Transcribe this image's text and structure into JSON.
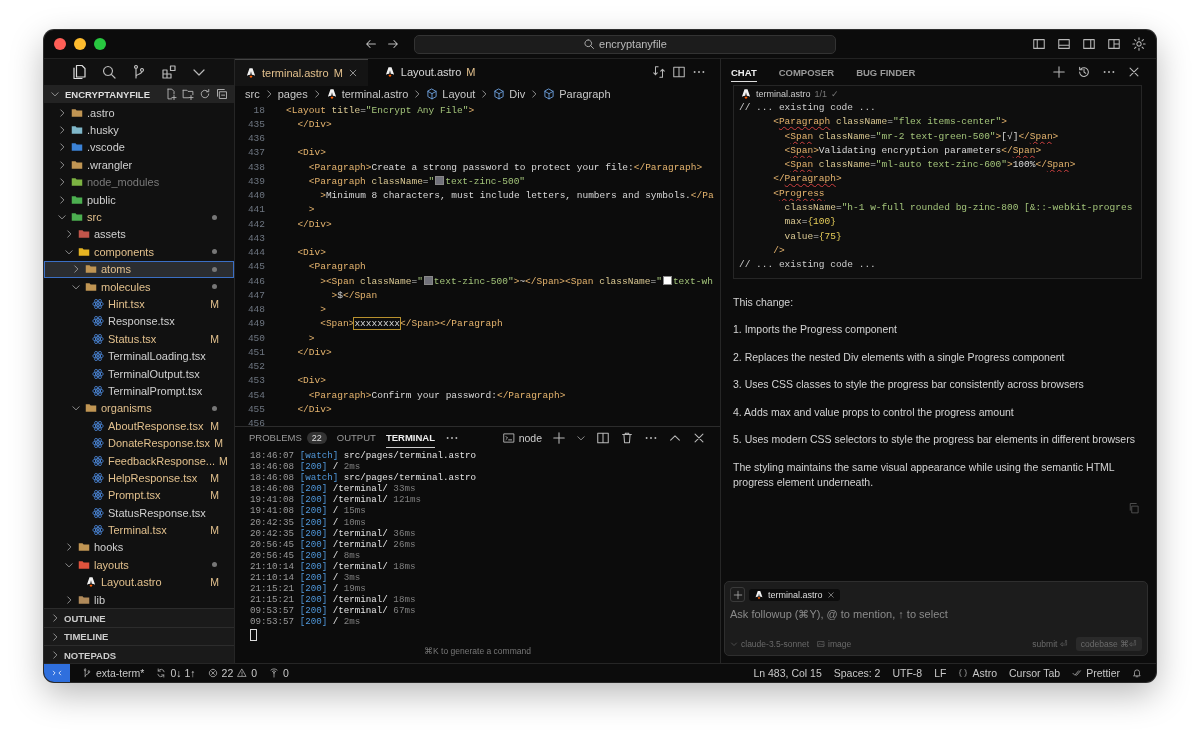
{
  "window": {
    "search": "encryptanyfile"
  },
  "sidebar": {
    "project": "ENCRYPTANYFILE",
    "tree": [
      {
        "name": ".astro",
        "kind": "folder",
        "color": "#c09553",
        "expanded": false,
        "modified": false,
        "ignored": false,
        "selected": false
      },
      {
        "name": ".husky",
        "kind": "folder",
        "color": "#7fb7c9",
        "expanded": false,
        "modified": false,
        "ignored": false,
        "selected": false
      },
      {
        "name": ".vscode",
        "kind": "folder",
        "color": "#3b82d6",
        "expanded": false,
        "modified": false,
        "ignored": false,
        "selected": false
      },
      {
        "name": ".wrangler",
        "kind": "folder",
        "color": "#c09553",
        "expanded": false,
        "modified": false,
        "ignored": false,
        "selected": false
      },
      {
        "name": "node_modules",
        "kind": "folder",
        "color": "#7cb342",
        "expanded": false,
        "modified": false,
        "ignored": true,
        "selected": false
      },
      {
        "name": "public",
        "kind": "folder",
        "color": "#4caf50",
        "expanded": false,
        "modified": false,
        "ignored": false,
        "selected": false
      },
      {
        "name": "src",
        "kind": "folder",
        "color": "#4caf50",
        "expanded": true,
        "modified": true,
        "ignored": false,
        "selected": false,
        "children": [
          {
            "name": "assets",
            "kind": "folder",
            "color": "#c2554a",
            "expanded": false,
            "modified": false,
            "ignored": false,
            "selected": false
          },
          {
            "name": "components",
            "kind": "folder",
            "color": "#e6b422",
            "expanded": true,
            "modified": true,
            "ignored": false,
            "selected": false,
            "children": [
              {
                "name": "atoms",
                "kind": "folder",
                "color": "#c09553",
                "expanded": false,
                "modified": true,
                "ignored": false,
                "selected": true
              },
              {
                "name": "molecules",
                "kind": "folder",
                "color": "#c09553",
                "expanded": true,
                "modified": true,
                "ignored": false,
                "selected": false,
                "children": [
                  {
                    "name": "Hint.tsx",
                    "kind": "react",
                    "modified": true,
                    "ignored": false,
                    "badge": "M",
                    "selected": false
                  },
                  {
                    "name": "Response.tsx",
                    "kind": "react",
                    "modified": false,
                    "ignored": false,
                    "selected": false
                  },
                  {
                    "name": "Status.tsx",
                    "kind": "react",
                    "modified": true,
                    "ignored": false,
                    "badge": "M",
                    "selected": false
                  },
                  {
                    "name": "TerminalLoading.tsx",
                    "kind": "react",
                    "modified": false,
                    "ignored": false,
                    "selected": false
                  },
                  {
                    "name": "TerminalOutput.tsx",
                    "kind": "react",
                    "modified": false,
                    "ignored": false,
                    "selected": false
                  },
                  {
                    "name": "TerminalPrompt.tsx",
                    "kind": "react",
                    "modified": false,
                    "ignored": false,
                    "selected": false
                  }
                ]
              },
              {
                "name": "organisms",
                "kind": "folder",
                "color": "#c09553",
                "expanded": true,
                "modified": true,
                "ignored": false,
                "selected": false,
                "children": [
                  {
                    "name": "AboutResponse.tsx",
                    "kind": "react",
                    "modified": true,
                    "ignored": false,
                    "badge": "M",
                    "selected": false
                  },
                  {
                    "name": "DonateResponse.tsx",
                    "kind": "react",
                    "modified": true,
                    "ignored": false,
                    "badge": "M",
                    "selected": false
                  },
                  {
                    "name": "FeedbackResponse...",
                    "kind": "react",
                    "modified": true,
                    "ignored": false,
                    "badge": "M",
                    "selected": false
                  },
                  {
                    "name": "HelpResponse.tsx",
                    "kind": "react",
                    "modified": true,
                    "ignored": false,
                    "badge": "M",
                    "selected": false
                  },
                  {
                    "name": "Prompt.tsx",
                    "kind": "react",
                    "modified": true,
                    "ignored": false,
                    "badge": "M",
                    "selected": false
                  },
                  {
                    "name": "StatusResponse.tsx",
                    "kind": "react",
                    "modified": false,
                    "ignored": false,
                    "selected": false
                  },
                  {
                    "name": "Terminal.tsx",
                    "kind": "react",
                    "modified": true,
                    "ignored": false,
                    "badge": "M",
                    "selected": false
                  }
                ]
              }
            ]
          },
          {
            "name": "hooks",
            "kind": "folder",
            "color": "#c09553",
            "expanded": false,
            "modified": false,
            "ignored": false,
            "selected": false
          },
          {
            "name": "layouts",
            "kind": "folder",
            "color": "#e0533d",
            "expanded": true,
            "modified": true,
            "ignored": false,
            "selected": false,
            "children": [
              {
                "name": "Layout.astro",
                "kind": "astro",
                "modified": true,
                "ignored": false,
                "badge": "M",
                "selected": false
              }
            ]
          },
          {
            "name": "lib",
            "kind": "folder",
            "color": "#b08a5a",
            "expanded": false,
            "modified": false,
            "ignored": false,
            "selected": false
          }
        ]
      }
    ],
    "sections": [
      {
        "label": "OUTLINE",
        "expanded": false
      },
      {
        "label": "TIMELINE",
        "expanded": false
      },
      {
        "label": "NOTEPADS",
        "expanded": false
      }
    ]
  },
  "editor": {
    "tabs": [
      {
        "label": "terminal.astro",
        "badge": "M",
        "selected": true
      },
      {
        "label": "Layout.astro",
        "badge": "M",
        "selected": false
      }
    ],
    "breadcrumbs": [
      {
        "label": "src",
        "kind": "folder"
      },
      {
        "label": "pages",
        "kind": "folder"
      },
      {
        "label": "terminal.astro",
        "kind": "file"
      },
      {
        "label": "Layout",
        "kind": "symbol"
      },
      {
        "label": "Div",
        "kind": "symbol"
      },
      {
        "label": "Paragraph",
        "kind": "symbol"
      }
    ],
    "lines": [
      {
        "n": "18",
        "tokens": [
          {
            "kind": "tag",
            "text": "<Layout"
          },
          {
            "kind": "attr",
            "text": " title"
          },
          {
            "kind": "punct",
            "text": "="
          },
          {
            "kind": "str",
            "text": "\"Encrypt Any File\""
          },
          {
            "kind": "tag",
            "text": ">"
          }
        ]
      },
      {
        "n": "435",
        "tokens": [
          {
            "kind": "tag",
            "text": "  </Div>"
          }
        ]
      },
      {
        "n": "436"
      },
      {
        "n": "437",
        "tokens": [
          {
            "kind": "tag",
            "text": "  <Div>"
          }
        ]
      },
      {
        "n": "438",
        "tokens": [
          {
            "kind": "tag",
            "text": "    <Paragraph>"
          },
          {
            "kind": "text",
            "text": "Create a strong password to protect your file:"
          },
          {
            "kind": "tag",
            "text": "</Paragraph>"
          }
        ]
      },
      {
        "n": "439",
        "tokens": [
          {
            "kind": "tag",
            "text": "    <Paragraph"
          },
          {
            "kind": "attr",
            "text": " className"
          },
          {
            "kind": "punct",
            "text": "="
          },
          {
            "kind": "str",
            "text": "\""
          },
          {
            "kind": "swatch",
            "color": "#71717a"
          },
          {
            "kind": "str",
            "text": "text-zinc-500\""
          }
        ]
      },
      {
        "n": "440",
        "tokens": [
          {
            "kind": "tag",
            "text": "      >"
          },
          {
            "kind": "text",
            "text": "Minimum 8 characters, must include letters, numbers and symbols."
          },
          {
            "kind": "tag",
            "text": "</Pa"
          }
        ]
      },
      {
        "n": "441",
        "tokens": [
          {
            "kind": "tag",
            "text": "    >"
          }
        ]
      },
      {
        "n": "442",
        "tokens": [
          {
            "kind": "tag",
            "text": "  </Div>"
          }
        ]
      },
      {
        "n": "443"
      },
      {
        "n": "444",
        "tokens": [
          {
            "kind": "tag",
            "text": "  <Div>"
          }
        ]
      },
      {
        "n": "445",
        "tokens": [
          {
            "kind": "tag",
            "text": "    <Paragraph"
          }
        ]
      },
      {
        "n": "446",
        "tokens": [
          {
            "kind": "tag",
            "text": "      ><Span"
          },
          {
            "kind": "attr",
            "text": " className"
          },
          {
            "kind": "punct",
            "text": "="
          },
          {
            "kind": "str",
            "text": "\""
          },
          {
            "kind": "swatch",
            "color": "#71717a"
          },
          {
            "kind": "str",
            "text": "text-zinc-500\""
          },
          {
            "kind": "tag",
            "text": ">"
          },
          {
            "kind": "text",
            "text": "~"
          },
          {
            "kind": "tag",
            "text": "</Span><Span"
          },
          {
            "kind": "attr",
            "text": " className"
          },
          {
            "kind": "punct",
            "text": "="
          },
          {
            "kind": "str",
            "text": "\""
          },
          {
            "kind": "swatch",
            "color": "#ffffff"
          },
          {
            "kind": "str",
            "text": "text-wh"
          }
        ]
      },
      {
        "n": "447",
        "tokens": [
          {
            "kind": "tag",
            "text": "        >"
          },
          {
            "kind": "text",
            "text": "$"
          },
          {
            "kind": "tag",
            "text": "</Span"
          }
        ]
      },
      {
        "n": "448",
        "tokens": [
          {
            "kind": "tag",
            "text": "      >"
          }
        ]
      },
      {
        "n": "449",
        "tokens": [
          {
            "kind": "tag",
            "text": "      <Span>"
          },
          {
            "kind": "match",
            "text": "xxxxxxxx"
          },
          {
            "kind": "tag",
            "text": "</Span></Paragraph"
          }
        ]
      },
      {
        "n": "450",
        "tokens": [
          {
            "kind": "tag",
            "text": "    >"
          }
        ]
      },
      {
        "n": "451",
        "tokens": [
          {
            "kind": "tag",
            "text": "  </Div>"
          }
        ]
      },
      {
        "n": "452"
      },
      {
        "n": "453",
        "tokens": [
          {
            "kind": "tag",
            "text": "  <Div>"
          }
        ]
      },
      {
        "n": "454",
        "tokens": [
          {
            "kind": "tag",
            "text": "    <Paragraph>"
          },
          {
            "kind": "text",
            "text": "Confirm your password:"
          },
          {
            "kind": "tag",
            "text": "</Paragraph>"
          }
        ]
      },
      {
        "n": "455",
        "tokens": [
          {
            "kind": "tag",
            "text": "  </Div>"
          }
        ]
      },
      {
        "n": "456"
      }
    ]
  },
  "panel": {
    "tabs": [
      {
        "label": "PROBLEMS",
        "count": "22",
        "selected": false
      },
      {
        "label": "OUTPUT",
        "selected": false
      },
      {
        "label": "TERMINAL",
        "selected": true
      }
    ],
    "shell": "node",
    "log": [
      {
        "time": "18:46:07",
        "tag": "[watch]",
        "path": "src/pages/terminal.astro"
      },
      {
        "time": "18:46:08",
        "tag": "[200]",
        "path": "/",
        "ms": "2ms"
      },
      {
        "time": "18:46:08",
        "tag": "[watch]",
        "path": "src/pages/terminal.astro"
      },
      {
        "time": "18:46:08",
        "tag": "[200]",
        "path": "/terminal/",
        "ms": "33ms"
      },
      {
        "time": "19:41:08",
        "tag": "[200]",
        "path": "/terminal/",
        "ms": "121ms"
      },
      {
        "time": "19:41:08",
        "tag": "[200]",
        "path": "/",
        "ms": "15ms"
      },
      {
        "time": "20:42:35",
        "tag": "[200]",
        "path": "/",
        "ms": "10ms"
      },
      {
        "time": "20:42:35",
        "tag": "[200]",
        "path": "/terminal/",
        "ms": "36ms"
      },
      {
        "time": "20:56:45",
        "tag": "[200]",
        "path": "/terminal/",
        "ms": "26ms"
      },
      {
        "time": "20:56:45",
        "tag": "[200]",
        "path": "/",
        "ms": "8ms"
      },
      {
        "time": "21:10:14",
        "tag": "[200]",
        "path": "/terminal/",
        "ms": "18ms"
      },
      {
        "time": "21:10:14",
        "tag": "[200]",
        "path": "/",
        "ms": "3ms"
      },
      {
        "time": "21:15:21",
        "tag": "[200]",
        "path": "/",
        "ms": "19ms"
      },
      {
        "time": "21:15:21",
        "tag": "[200]",
        "path": "/terminal/",
        "ms": "18ms"
      },
      {
        "time": "09:53:57",
        "tag": "[200]",
        "path": "/terminal/",
        "ms": "67ms"
      },
      {
        "time": "09:53:57",
        "tag": "[200]",
        "path": "/",
        "ms": "2ms"
      }
    ],
    "hint": "⌘K to generate a command"
  },
  "chat": {
    "tabs": [
      {
        "label": "CHAT",
        "selected": true
      },
      {
        "label": "COMPOSER",
        "selected": false
      },
      {
        "label": "BUG FINDER",
        "selected": false
      }
    ],
    "code": {
      "file": "terminal.astro",
      "count": "1/1",
      "status": "✓",
      "lines": [
        {
          "tokens": [
            {
              "kind": "comment",
              "text": "// ... existing code ..."
            }
          ]
        },
        {
          "tokens": [
            {
              "kind": "tag",
              "text": "      <"
            },
            {
              "kind": "flagged",
              "text": "Paragraph"
            },
            {
              "kind": "attr",
              "text": " className"
            },
            {
              "kind": "punct",
              "text": "="
            },
            {
              "kind": "str",
              "text": "\"flex items-center\""
            },
            {
              "kind": "tag",
              "text": ">"
            }
          ]
        },
        {
          "tokens": [
            {
              "kind": "tag",
              "text": "        <"
            },
            {
              "kind": "flagged",
              "text": "Span"
            },
            {
              "kind": "attr",
              "text": " className"
            },
            {
              "kind": "punct",
              "text": "="
            },
            {
              "kind": "str",
              "text": "\"mr-2 text-green-500\""
            },
            {
              "kind": "tag",
              "text": ">"
            },
            {
              "kind": "text",
              "text": "[√]"
            },
            {
              "kind": "tag",
              "text": "</"
            },
            {
              "kind": "flagged",
              "text": "Span"
            },
            {
              "kind": "tag",
              "text": ">"
            }
          ]
        },
        {
          "tokens": [
            {
              "kind": "tag",
              "text": "        <"
            },
            {
              "kind": "flagged",
              "text": "Span"
            },
            {
              "kind": "tag",
              "text": ">"
            },
            {
              "kind": "text",
              "text": "Validating encryption parameters"
            },
            {
              "kind": "tag",
              "text": "</"
            },
            {
              "kind": "flagged",
              "text": "Span"
            },
            {
              "kind": "tag",
              "text": ">"
            }
          ]
        },
        {
          "tokens": [
            {
              "kind": "tag",
              "text": "        <"
            },
            {
              "kind": "flagged",
              "text": "Span"
            },
            {
              "kind": "attr",
              "text": " className"
            },
            {
              "kind": "punct",
              "text": "="
            },
            {
              "kind": "str",
              "text": "\"ml-auto text-zinc-600\""
            },
            {
              "kind": "tag",
              "text": ">"
            },
            {
              "kind": "text",
              "text": "100%"
            },
            {
              "kind": "tag",
              "text": "</"
            },
            {
              "kind": "flagged",
              "text": "Span"
            },
            {
              "kind": "tag",
              "text": ">"
            }
          ]
        },
        {
          "tokens": [
            {
              "kind": "tag",
              "text": "      </"
            },
            {
              "kind": "flagged",
              "text": "Paragraph"
            },
            {
              "kind": "tag",
              "text": ">"
            }
          ]
        },
        {
          "tokens": [
            {
              "kind": "tag",
              "text": "      <"
            },
            {
              "kind": "flagged",
              "text": "Progress"
            }
          ]
        },
        {
          "tokens": [
            {
              "kind": "attr",
              "text": "        className"
            },
            {
              "kind": "punct",
              "text": "="
            },
            {
              "kind": "str",
              "text": "\"h-1 w-full rounded bg-zinc-800 [&::-webkit-progres"
            }
          ]
        },
        {
          "tokens": [
            {
              "kind": "attr",
              "text": "        max"
            },
            {
              "kind": "punct",
              "text": "="
            },
            {
              "kind": "num",
              "text": "{100}"
            }
          ]
        },
        {
          "tokens": [
            {
              "kind": "attr",
              "text": "        value"
            },
            {
              "kind": "punct",
              "text": "="
            },
            {
              "kind": "num",
              "text": "{75}"
            }
          ]
        },
        {
          "tokens": [
            {
              "kind": "tag",
              "text": "      />"
            }
          ]
        },
        {
          "tokens": [
            {
              "kind": "comment",
              "text": "// ... existing code ..."
            }
          ]
        }
      ]
    },
    "paragraphs": [
      "This change:",
      "1. Imports the Progress component",
      "2. Replaces the nested Div elements with a single Progress component",
      "3. Uses CSS classes to style the progress bar consistently across browsers",
      "4. Adds max and value props to control the progress amount",
      "5. Uses modern CSS selectors to style the progress bar elements in different browsers",
      "The styling maintains the same visual appearance while using the semantic HTML progress element underneath."
    ],
    "input": {
      "chip": "terminal.astro",
      "placeholder": "Ask followup (⌘Y), @ to mention, ↑ to select",
      "model": "claude-3.5-sonnet",
      "image": "image",
      "submit": "submit ⏎",
      "codebase": "codebase ⌘⏎"
    }
  },
  "status_bar": {
    "branch": "exta-term*",
    "sync": "0↓ 1↑",
    "errors": "22",
    "warnings": "0",
    "ports": "0",
    "right": [
      {
        "label": "Ln 483, Col 15",
        "kind": "text"
      },
      {
        "label": "Spaces: 2",
        "kind": "text"
      },
      {
        "label": "UTF-8",
        "kind": "text"
      },
      {
        "label": "LF",
        "kind": "text"
      },
      {
        "label": "Astro",
        "kind": "language"
      },
      {
        "label": "Cursor Tab",
        "kind": "text"
      },
      {
        "label": "Prettier",
        "kind": "formatter"
      }
    ]
  }
}
